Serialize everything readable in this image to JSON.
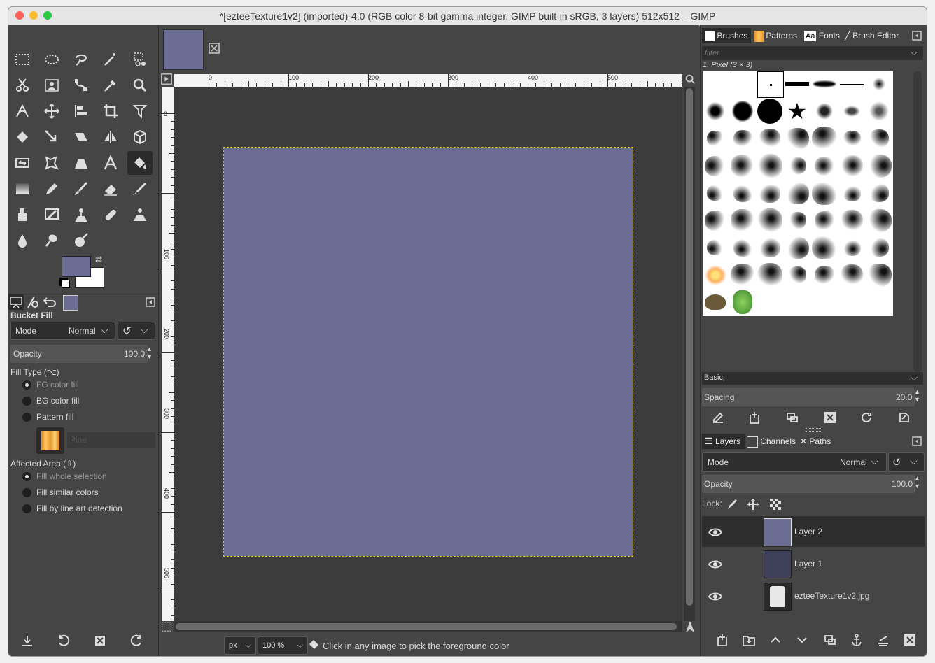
{
  "window": {
    "title": "*[ezteeTexture1v2] (imported)-4.0 (RGB color 8-bit gamma integer, GIMP built-in sRGB, 3 layers) 512x512 – GIMP"
  },
  "colors": {
    "foreground": "#6c6d93",
    "background": "#ffffff",
    "image_fill": "#6c6d93",
    "dock_bg": "#454545"
  },
  "tool_options": {
    "title": "Bucket Fill",
    "mode_label": "Mode",
    "mode_value": "Normal",
    "opacity_label": "Opacity",
    "opacity_value": "100.0",
    "fill_type_label": "Fill Type  (⌥)",
    "fill_types": [
      "FG color fill",
      "BG color fill",
      "Pattern fill"
    ],
    "pattern_name": "Pine",
    "affected_area_label": "Affected Area  (⇧)",
    "affected_areas": [
      "Fill whole selection",
      "Fill similar colors",
      "Fill by line art detection"
    ]
  },
  "rulers": {
    "h_ticks": [
      "0",
      "100",
      "200",
      "300",
      "400",
      "500"
    ],
    "v_ticks": [
      "0",
      "100",
      "200",
      "300",
      "400",
      "500"
    ]
  },
  "statusbar": {
    "unit": "px",
    "zoom": "100 %",
    "message": "Click in any image to pick the foreground color"
  },
  "brushes_panel": {
    "tabs": [
      "Brushes",
      "Patterns",
      "Fonts",
      "Brush Editor"
    ],
    "filter_placeholder": "filter",
    "selected_brush": "1. Pixel (3 × 3)",
    "tag_value": "Basic,",
    "spacing_label": "Spacing",
    "spacing_value": "20.0"
  },
  "layers_panel": {
    "tabs": [
      "Layers",
      "Channels",
      "Paths"
    ],
    "mode_label": "Mode",
    "mode_value": "Normal",
    "opacity_label": "Opacity",
    "opacity_value": "100.0",
    "lock_label": "Lock:",
    "layers": [
      {
        "name": "Layer 2",
        "thumb": "#6c6d93"
      },
      {
        "name": "Layer 1",
        "thumb": "#3e3f58"
      },
      {
        "name": "ezteeTexture1v2.jpg",
        "thumb": "#d8d8d8"
      }
    ]
  }
}
